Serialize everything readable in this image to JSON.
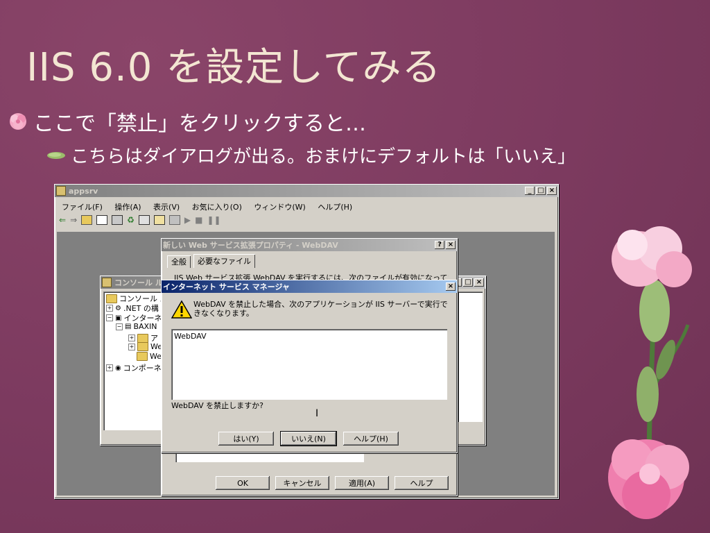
{
  "slide": {
    "title": "IIS 6.0 を設定してみる",
    "bullet1": "ここで「禁止」をクリックすると…",
    "bullet2": "こちらはダイアログが出る。おまけにデフォルトは「いいえ」"
  },
  "appsrv": {
    "title": "appsrv",
    "menu": [
      "ファイル(F)",
      "操作(A)",
      "表示(V)",
      "お気に入り(O)",
      "ウィンドウ(W)",
      "ヘルプ(H)"
    ]
  },
  "console": {
    "title": "コンソール ル",
    "tree": [
      "コンソール ルー",
      ".NET の構",
      "インターネッ",
      "BAXIN",
      "ア",
      "We",
      "We",
      "コンポーネン"
    ]
  },
  "props": {
    "title": "新しい Web サービス拡張プロパティ - WebDAV",
    "tabs": [
      "全般",
      "必要なファイル"
    ],
    "desc": "IIS Web サービス拡張 WebDAV を実行するには、次のファイルが有効になっている必要があ",
    "buttons": {
      "ok": "OK",
      "cancel": "キャンセル",
      "apply": "適用(A)",
      "help": "ヘルプ"
    }
  },
  "dialog": {
    "title": "インターネット サービス マネージャ",
    "message": "WebDAV を禁止した場合、次のアプリケーションが IIS サーバーで実行できなくなります。",
    "list": [
      "WebDAV"
    ],
    "question": "WebDAV を禁止しますか?",
    "buttons": {
      "yes": "はい(Y)",
      "no": "いいえ(N)",
      "help": "ヘルプ(H)"
    }
  },
  "colors": {
    "slide_bg": "#7c3a5f",
    "title_text": "#f3e6d2",
    "titlebar": "#0a246a"
  }
}
